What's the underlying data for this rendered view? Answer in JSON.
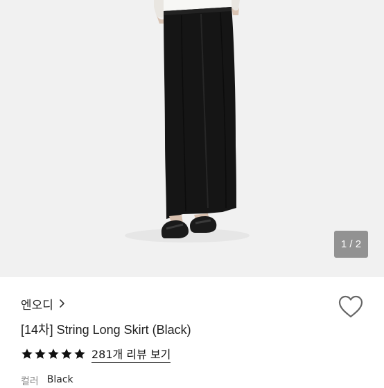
{
  "gallery": {
    "page_indicator": "1 / 2",
    "image_subject": "model wearing black long skirt and flat sandals"
  },
  "product": {
    "seller_name": "엔오디",
    "title": "[14차] String Long Skirt (Black)",
    "rating": 5,
    "rating_max": 5,
    "review_link": "281개 리뷰 보기",
    "option_label": "컬러",
    "option_value": "Black"
  },
  "icons": {
    "seller_chevron": "chevron-right-icon",
    "favorite": "heart-outline-icon",
    "rating_star": "star-filled-icon"
  },
  "colors": {
    "photo_background": "#f1f1f1",
    "skirt": "#151515",
    "star": "#111111",
    "heart_outline": "#666666"
  }
}
